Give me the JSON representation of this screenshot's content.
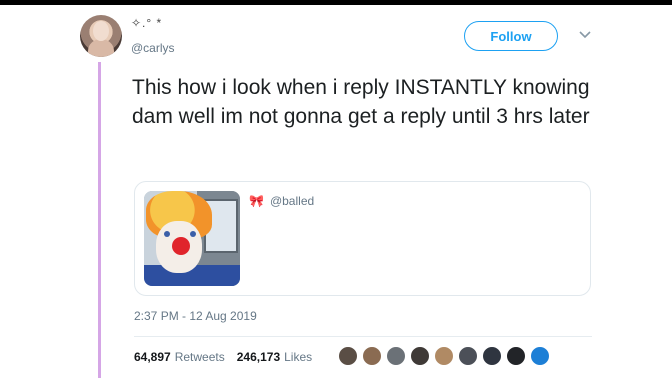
{
  "tweet": {
    "display_name": "✧.° *",
    "handle": "@carlys",
    "follow_label": "Follow",
    "text": "This how i look when i reply INSTANTLY knowing dam well im not gonna get a reply until 3 hrs later",
    "quote": {
      "bow_icon": "🎀",
      "handle": "@balled"
    },
    "timestamp": "2:37 PM - 12 Aug 2019",
    "retweets_count": "64,897",
    "retweets_label": "Retweets",
    "likes_count": "246,173",
    "likes_label": "Likes"
  },
  "colors": {
    "accent": "#1da1f2",
    "thread_line": "#d5a6e6",
    "muted_text": "#657786"
  },
  "likers": [
    {
      "icon": "avatar",
      "color": "#5a4e45"
    },
    {
      "icon": "avatar",
      "color": "#8a6b52"
    },
    {
      "icon": "avatar",
      "color": "#6b7177"
    },
    {
      "icon": "avatar",
      "color": "#3f3a37"
    },
    {
      "icon": "avatar",
      "color": "#b08a64"
    },
    {
      "icon": "avatar",
      "color": "#4c5058"
    },
    {
      "icon": "avatar",
      "color": "#2f3540"
    },
    {
      "icon": "avatar",
      "color": "#222428"
    },
    {
      "icon": "avatar",
      "color": "#1d7fd6"
    }
  ]
}
